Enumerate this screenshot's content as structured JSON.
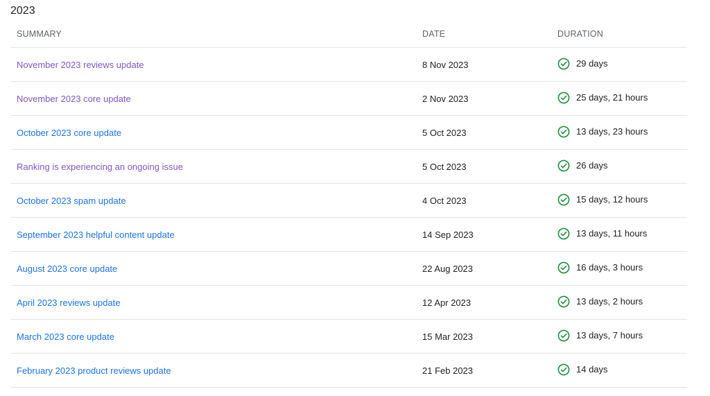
{
  "section": {
    "year": "2023"
  },
  "table": {
    "headers": {
      "summary": "SUMMARY",
      "date": "DATE",
      "duration": "DURATION"
    },
    "status_icon": "check-circle-icon",
    "colors": {
      "visited_link": "#7e57c2",
      "link": "#1a73e8",
      "status_ok": "#1e8e3e"
    },
    "rows": [
      {
        "summary": "November 2023 reviews update",
        "date": "8 Nov 2023",
        "duration": "29 days",
        "visited": true
      },
      {
        "summary": "November 2023 core update",
        "date": "2 Nov 2023",
        "duration": "25 days, 21 hours",
        "visited": true
      },
      {
        "summary": "October 2023 core update",
        "date": "5 Oct 2023",
        "duration": "13 days, 23 hours",
        "visited": false
      },
      {
        "summary": "Ranking is experiencing an ongoing issue",
        "date": "5 Oct 2023",
        "duration": "26 days",
        "visited": true
      },
      {
        "summary": "October 2023 spam update",
        "date": "4 Oct 2023",
        "duration": "15 days, 12 hours",
        "visited": false
      },
      {
        "summary": "September 2023 helpful content update",
        "date": "14 Sep 2023",
        "duration": "13 days, 11 hours",
        "visited": false
      },
      {
        "summary": "August 2023 core update",
        "date": "22 Aug 2023",
        "duration": "16 days, 3 hours",
        "visited": false
      },
      {
        "summary": "April 2023 reviews update",
        "date": "12 Apr 2023",
        "duration": "13 days, 2 hours",
        "visited": false
      },
      {
        "summary": "March 2023 core update",
        "date": "15 Mar 2023",
        "duration": "13 days, 7 hours",
        "visited": false
      },
      {
        "summary": "February 2023 product reviews update",
        "date": "21 Feb 2023",
        "duration": "14 days",
        "visited": false
      }
    ]
  }
}
